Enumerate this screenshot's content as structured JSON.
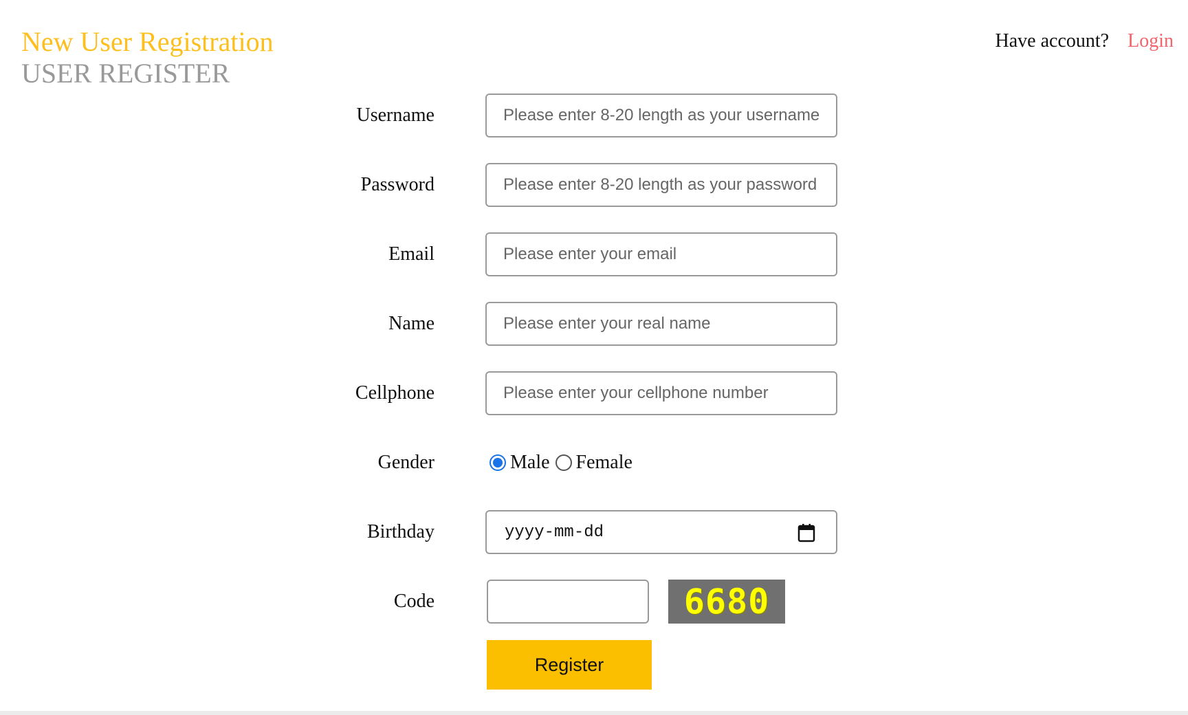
{
  "header": {
    "title": "New User Registration",
    "subtitle": "USER REGISTER",
    "account_question": "Have account?",
    "login_link": "Login"
  },
  "form": {
    "username": {
      "label": "Username",
      "placeholder": "Please enter 8-20 length as your username",
      "value": ""
    },
    "password": {
      "label": "Password",
      "placeholder": "Please enter 8-20 length as your password",
      "value": ""
    },
    "email": {
      "label": "Email",
      "placeholder": "Please enter your email",
      "value": ""
    },
    "name": {
      "label": "Name",
      "placeholder": "Please enter your real name",
      "value": ""
    },
    "cellphone": {
      "label": "Cellphone",
      "placeholder": "Please enter your cellphone number",
      "value": ""
    },
    "gender": {
      "label": "Gender",
      "options": [
        "Male",
        "Female"
      ],
      "selected": "Male"
    },
    "birthday": {
      "label": "Birthday",
      "display": "yyyy-mm-dd"
    },
    "code": {
      "label": "Code",
      "value": "",
      "captcha": "6680"
    },
    "submit_label": "Register"
  },
  "colors": {
    "title": "#fcbf1e",
    "subtitle": "#999999",
    "login_link": "#f2646c",
    "button": "#fcbf00",
    "captcha_bg": "#707070",
    "captcha_text": "#ffff00",
    "radio_selected": "#1a73e8"
  },
  "icons": {
    "birthday_picker": "calendar-icon"
  }
}
